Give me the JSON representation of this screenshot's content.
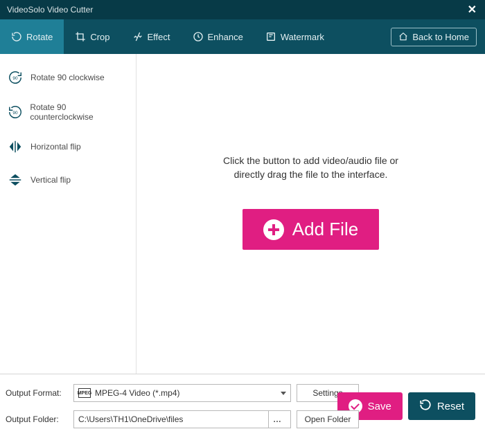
{
  "title": "VideoSolo Video Cutter",
  "tabs": {
    "rotate": "Rotate",
    "crop": "Crop",
    "effect": "Effect",
    "enhance": "Enhance",
    "watermark": "Watermark"
  },
  "back_home": "Back to Home",
  "sidebar": {
    "rotate_cw": "Rotate 90 clockwise",
    "rotate_ccw": "Rotate 90 counterclockwise",
    "hflip": "Horizontal flip",
    "vflip": "Vertical flip"
  },
  "main": {
    "hint_line1": "Click the button to add video/audio file or",
    "hint_line2": "directly drag the file to the interface.",
    "add_file": "Add File"
  },
  "bottom": {
    "output_format_label": "Output Format:",
    "output_format_value": "MPEG-4 Video (*.mp4)",
    "settings": "Settings",
    "output_folder_label": "Output Folder:",
    "output_folder_value": "C:\\Users\\TH1\\OneDrive\\files",
    "open_folder": "Open Folder",
    "save": "Save",
    "reset": "Reset"
  }
}
